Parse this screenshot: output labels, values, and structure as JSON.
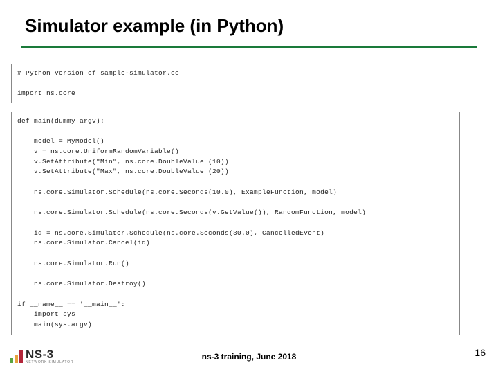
{
  "slide": {
    "title": "Simulator example (in Python)",
    "code_block_1": "# Python version of sample-simulator.cc\n\nimport ns.core",
    "code_block_2": "def main(dummy_argv):\n\n    model = MyModel()\n    v = ns.core.UniformRandomVariable()\n    v.SetAttribute(\"Min\", ns.core.DoubleValue (10))\n    v.SetAttribute(\"Max\", ns.core.DoubleValue (20))\n\n    ns.core.Simulator.Schedule(ns.core.Seconds(10.0), ExampleFunction, model)\n\n    ns.core.Simulator.Schedule(ns.core.Seconds(v.GetValue()), RandomFunction, model)\n\n    id = ns.core.Simulator.Schedule(ns.core.Seconds(30.0), CancelledEvent)\n    ns.core.Simulator.Cancel(id)\n\n    ns.core.Simulator.Run()\n\n    ns.core.Simulator.Destroy()\n\nif __name__ == '__main__':\n    import sys\n    main(sys.argv)",
    "footer_text": "ns-3 training, June 2018",
    "page_number": "16",
    "logo": {
      "main": "NS-3",
      "sub": "NETWORK SIMULATOR"
    }
  }
}
